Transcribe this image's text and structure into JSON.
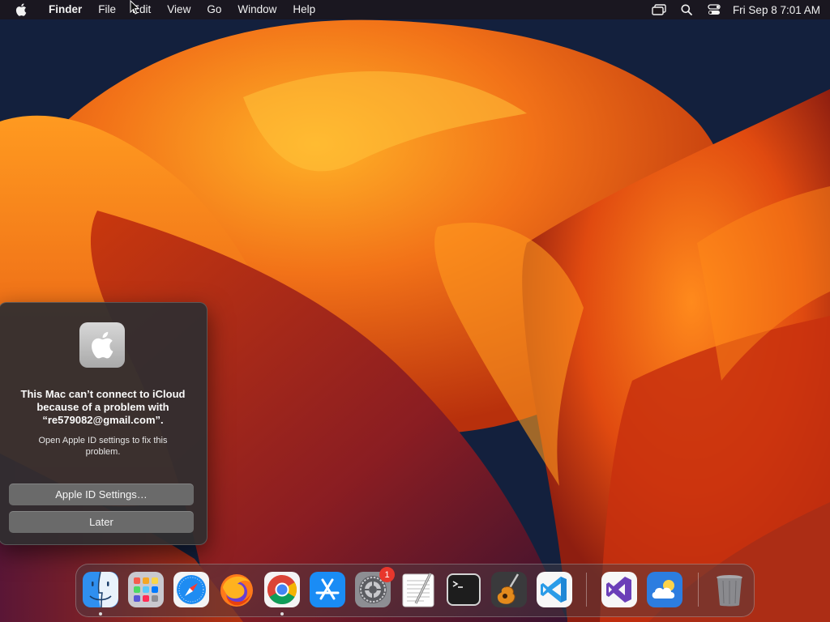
{
  "menubar": {
    "apple_icon": "apple-logo-icon",
    "app_name": "Finder",
    "menus": [
      "File",
      "Edit",
      "View",
      "Go",
      "Window",
      "Help"
    ],
    "status_icons": [
      "screen-mirroring-icon",
      "spotlight-search-icon",
      "control-center-icon"
    ],
    "clock": "Fri Sep 8  7:01 AM"
  },
  "alert": {
    "icon": "apple-id-logo-icon",
    "title": "This Mac can’t connect to iCloud because of a problem with “re579082@gmail.com”.",
    "body": "Open Apple ID settings to fix this problem.",
    "primary_button": "Apple ID Settings…",
    "secondary_button": "Later"
  },
  "dock": {
    "items": [
      {
        "name": "Finder",
        "icon": "finder-icon",
        "running": true
      },
      {
        "name": "Launchpad",
        "icon": "launchpad-icon",
        "running": false
      },
      {
        "name": "Safari",
        "icon": "safari-icon",
        "running": false
      },
      {
        "name": "Firefox",
        "icon": "firefox-icon",
        "running": false
      },
      {
        "name": "Google Chrome",
        "icon": "chrome-icon",
        "running": true
      },
      {
        "name": "App Store",
        "icon": "app-store-icon",
        "running": false
      },
      {
        "name": "System Settings",
        "icon": "system-settings-icon",
        "running": false,
        "badge": "1"
      },
      {
        "name": "TextEdit",
        "icon": "textedit-icon",
        "running": false
      },
      {
        "name": "Terminal",
        "icon": "terminal-icon",
        "running": false
      },
      {
        "name": "GarageBand",
        "icon": "garageband-icon",
        "running": false
      },
      {
        "name": "Visual Studio Code",
        "icon": "vscode-icon",
        "running": false
      },
      {
        "name": "Visual Studio",
        "icon": "visual-studio-icon",
        "running": false
      },
      {
        "name": "Weather",
        "icon": "weather-icon",
        "running": false
      },
      {
        "name": "Trash",
        "icon": "trash-icon",
        "running": false
      }
    ]
  },
  "colors": {
    "accent_badge": "#e8372c",
    "wallpaper_orange": "#f07a18",
    "wallpaper_red": "#c2280e",
    "wallpaper_navy": "#0f1a35"
  }
}
